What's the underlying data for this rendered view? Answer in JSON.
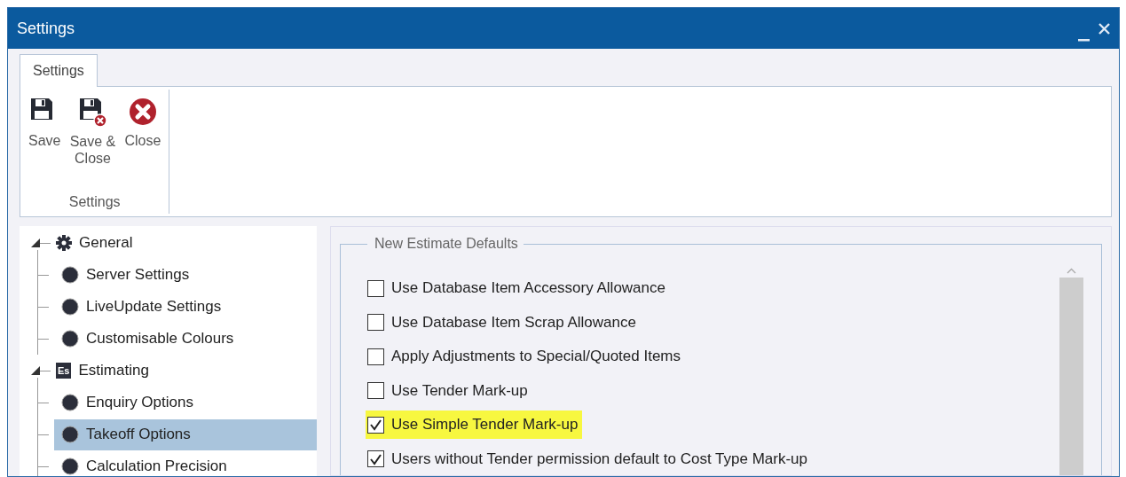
{
  "window": {
    "title": "Settings"
  },
  "ribbon": {
    "tabs": [
      {
        "label": "Settings",
        "selected": true
      }
    ],
    "groups": [
      {
        "label": "Settings",
        "buttons": [
          {
            "kind": "save",
            "label": "Save"
          },
          {
            "kind": "save-close",
            "label": "Save & Close"
          },
          {
            "kind": "close",
            "label": "Close"
          }
        ]
      }
    ]
  },
  "tree": [
    {
      "label": "General",
      "kind": "gear",
      "expanded": true,
      "selected": false,
      "children": [
        {
          "label": "Server Settings",
          "selected": false
        },
        {
          "label": "LiveUpdate Settings",
          "selected": false
        },
        {
          "label": "Customisable Colours",
          "selected": false
        }
      ]
    },
    {
      "label": "Estimating",
      "kind": "badge",
      "badge": "Es",
      "expanded": true,
      "selected": false,
      "children": [
        {
          "label": "Enquiry Options",
          "selected": false
        },
        {
          "label": "Takeoff Options",
          "selected": true
        },
        {
          "label": "Calculation Precision",
          "selected": false
        }
      ]
    }
  ],
  "options": {
    "title": "New Estimate Defaults",
    "items": [
      {
        "label": "Use Database Item Accessory Allowance",
        "checked": false,
        "highlighted": false
      },
      {
        "label": "Use Database Item Scrap Allowance",
        "checked": false,
        "highlighted": false
      },
      {
        "label": "Apply Adjustments to Special/Quoted Items",
        "checked": false,
        "highlighted": false
      },
      {
        "label": "Use Tender Mark-up",
        "checked": false,
        "highlighted": false
      },
      {
        "label": "Use Simple Tender Mark-up",
        "checked": true,
        "highlighted": true
      },
      {
        "label": "Users without Tender permission default to Cost Type Mark-up",
        "checked": true,
        "highlighted": false
      }
    ]
  }
}
